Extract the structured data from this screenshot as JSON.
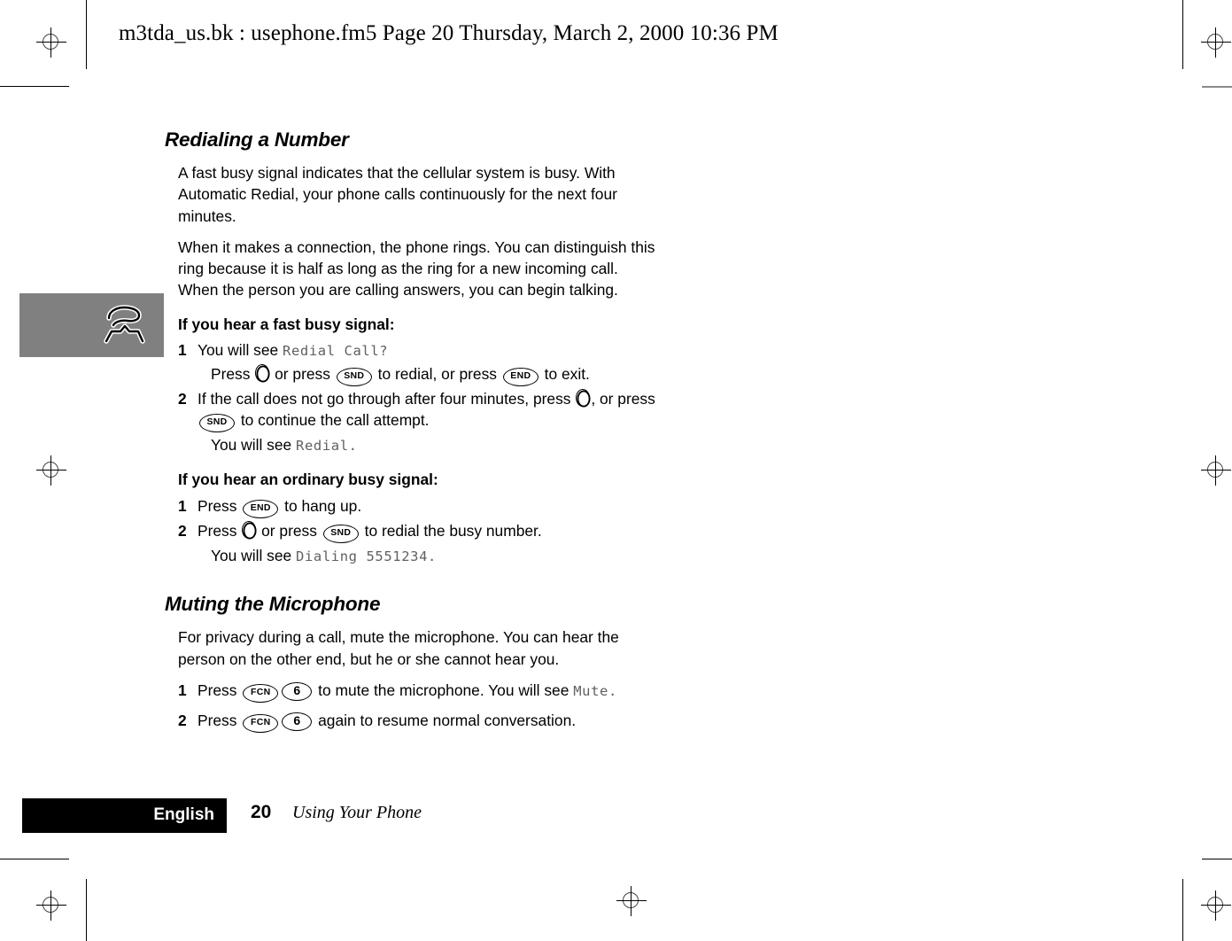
{
  "header": {
    "running_head": "m3tda_us.bk : usephone.fm5  Page 20  Thursday, March 2, 2000  10:36 PM"
  },
  "chapter_tab": {
    "icon": "phone-handset-icon",
    "background_color": "#808080"
  },
  "sections": [
    {
      "title": "Redialing a Number",
      "paragraphs": [
        "A fast busy signal indicates that the cellular system is busy. With Automatic Redial, your phone calls continuously for the next four minutes.",
        "When it makes a connection, the phone rings. You can distinguish this ring because it is half as long as the ring for a new incoming call. When the person you are calling answers, you can begin talking."
      ],
      "subsections": [
        {
          "heading": "If you hear a fast busy signal:",
          "steps": [
            {
              "number": "1",
              "text_before": "You will see ",
              "lcd": "Redial Call?",
              "continuation_before": "Press ",
              "continuation_mid1": " or press ",
              "continuation_mid2": " to redial, or press ",
              "continuation_after": " to exit."
            },
            {
              "number": "2",
              "text_before": "If the call does not go through after four minutes, press ",
              "text_mid": ", or press ",
              "text_after": " to continue the call attempt.",
              "continuation_before": "You will see ",
              "lcd": "Redial."
            }
          ]
        },
        {
          "heading": "If you hear an ordinary busy signal:",
          "steps": [
            {
              "number": "1",
              "text_before": "Press ",
              "text_after": " to hang up."
            },
            {
              "number": "2",
              "text_before": "Press ",
              "text_mid": " or press ",
              "text_after": " to redial the busy number.",
              "continuation_before": "You will see ",
              "lcd": "Dialing 5551234."
            }
          ]
        }
      ]
    },
    {
      "title": "Muting the Microphone",
      "paragraphs": [
        "For privacy during a call, mute the microphone. You can hear the person on the other end, but he or she cannot hear you."
      ],
      "steps": [
        {
          "number": "1",
          "text_before": "Press ",
          "text_after": " to mute the microphone. You will see ",
          "lcd": "Mute."
        },
        {
          "number": "2",
          "text_before": "Press ",
          "text_after": " again to resume normal conversation."
        }
      ]
    }
  ],
  "keys": {
    "snd": "SND",
    "end": "END",
    "fcn": "FCN",
    "six": "6",
    "nav": "nav-diamond-key"
  },
  "footer": {
    "language": "English",
    "page_number": "20",
    "chapter_name": "Using Your Phone"
  }
}
